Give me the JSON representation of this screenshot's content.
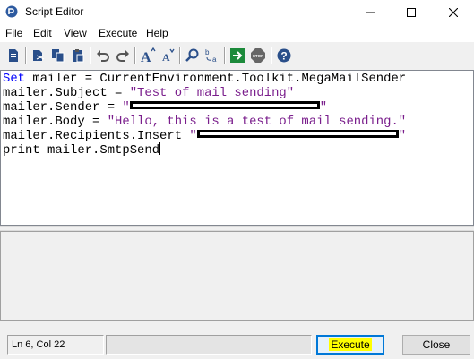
{
  "window": {
    "title": "Script Editor"
  },
  "menu": {
    "items": [
      "File",
      "Edit",
      "View",
      "Execute",
      "Help"
    ]
  },
  "toolbar": {
    "buttons": [
      "new-script-icon",
      "cut-icon",
      "copy-icon",
      "paste-icon",
      "undo-icon",
      "redo-icon",
      "font-increase-icon",
      "font-decrease-icon",
      "find-icon",
      "replace-icon",
      "run-icon",
      "stop-icon",
      "help-icon"
    ]
  },
  "editor": {
    "lines": [
      {
        "kw": "Set",
        "rest": " mailer = CurrentEnvironment.Toolkit.MegaMailSender"
      },
      {
        "pre": "mailer.Subject = ",
        "str": "\"Test of mail sending\""
      },
      {
        "pre": "mailer.Sender = ",
        "str_open": "\"",
        "str_close": "\""
      },
      {
        "pre": "mailer.Body = ",
        "str": "\"Hello, this is a test of mail sending.\""
      },
      {
        "pre": "mailer.Recipients.Insert ",
        "str_open": "\"",
        "str_close": "\""
      },
      {
        "pre": "print mailer.SmtpSend"
      }
    ]
  },
  "status": {
    "position": "Ln 6, Col 22"
  },
  "buttons": {
    "execute": "Execute",
    "close": "Close"
  },
  "colors": {
    "keyword": "#0000ff",
    "string": "#7a1e8c",
    "execute_highlight": "#ffff00"
  }
}
